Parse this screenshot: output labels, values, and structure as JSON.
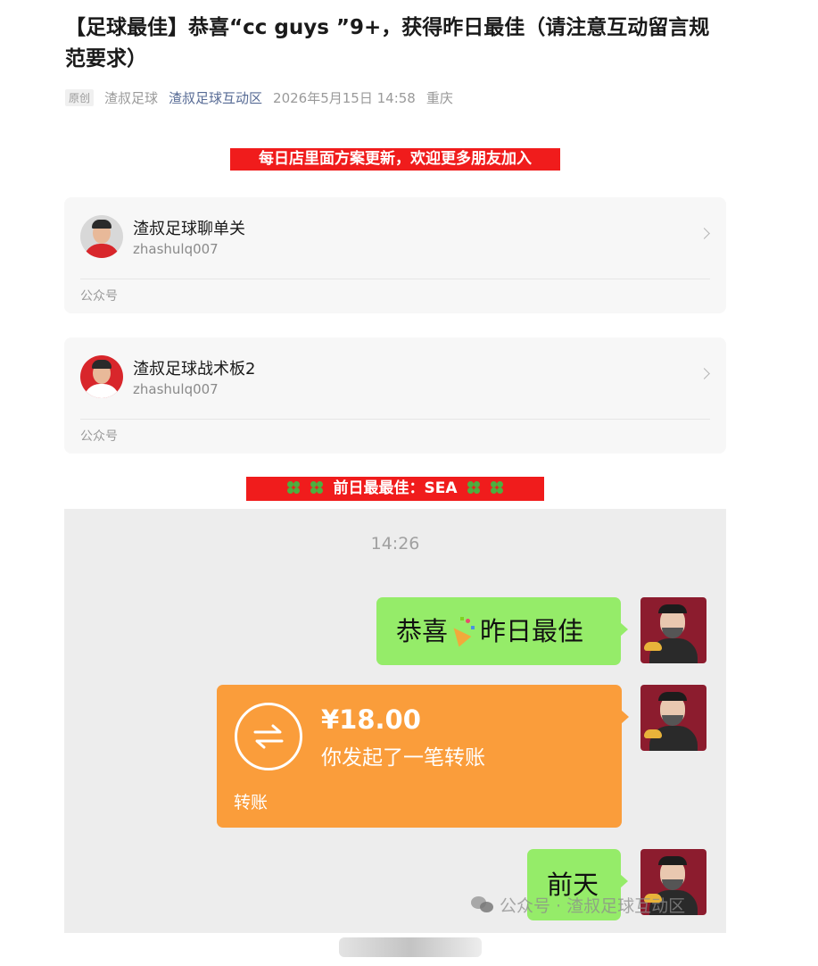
{
  "article": {
    "title": "【足球最佳】恭喜“cc guys ”9+，获得昨日最佳（请注意互动留言规范要求）",
    "original_tag": "原创",
    "author": "渣叔足球",
    "account_link": "渣叔足球互动区",
    "date": "2026年5月15日 14:58",
    "location": "重庆"
  },
  "banner_top": "每日店里面方案更新，欢迎更多朋友加入",
  "cards": [
    {
      "name": "渣叔足球聊单关",
      "wxid": "zhashulq007",
      "type": "公众号"
    },
    {
      "name": "渣叔足球战术板2",
      "wxid": "zhashulq007",
      "type": "公众号"
    }
  ],
  "banner_best": "前日最最佳：SEA",
  "chat": {
    "time": "14:26",
    "msg1_before": "恭喜",
    "msg1_after": "昨日最佳",
    "transfer_amount": "¥18.00",
    "transfer_desc": "你发起了一笔转账",
    "transfer_footer": "转账",
    "msg3": "前天",
    "watermark": "公众号 · 渣叔足球互动区"
  },
  "colors": {
    "banner_red": "#f01c1c",
    "bubble_green": "#95ec69",
    "transfer_orange": "#fa9d3b",
    "link_blue": "#576b95"
  }
}
